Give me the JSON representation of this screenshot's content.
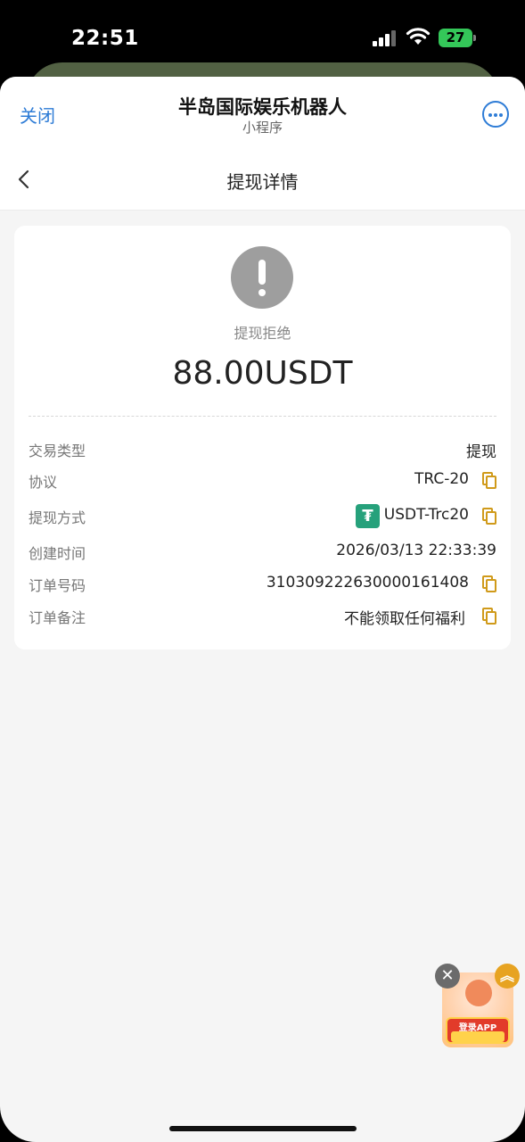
{
  "status_bar": {
    "time": "22:51",
    "battery_level": "27",
    "battery_color": "#34c759"
  },
  "miniprogram": {
    "close_label": "关闭",
    "title": "半岛国际娱乐机器人",
    "subtitle": "小程序",
    "accent_color": "#2e7cd6"
  },
  "nav": {
    "title": "提现详情"
  },
  "withdrawal": {
    "status_icon": "exclamation-icon",
    "status_text": "提现拒绝",
    "amount": "88.00USDT",
    "copy_icon_color": "#d09a1a",
    "rows": [
      {
        "label": "交易类型",
        "value": "提现",
        "copyable": false
      },
      {
        "label": "协议",
        "value": "TRC-20",
        "copyable": true
      },
      {
        "label": "提现方式",
        "value": "USDT-Trc20",
        "copyable": true,
        "icon": "tether-icon"
      },
      {
        "label": "创建时间",
        "value": "2026/03/13 22:33:39",
        "copyable": false
      },
      {
        "label": "订单号码",
        "value": "310309222630000161408",
        "copyable": true
      },
      {
        "label": "订单备注",
        "value": "不能领取任何福利",
        "copyable": true
      }
    ]
  },
  "promo": {
    "close_glyph": "✕",
    "expand_glyph": "︽",
    "badge_text": "登录APP"
  }
}
